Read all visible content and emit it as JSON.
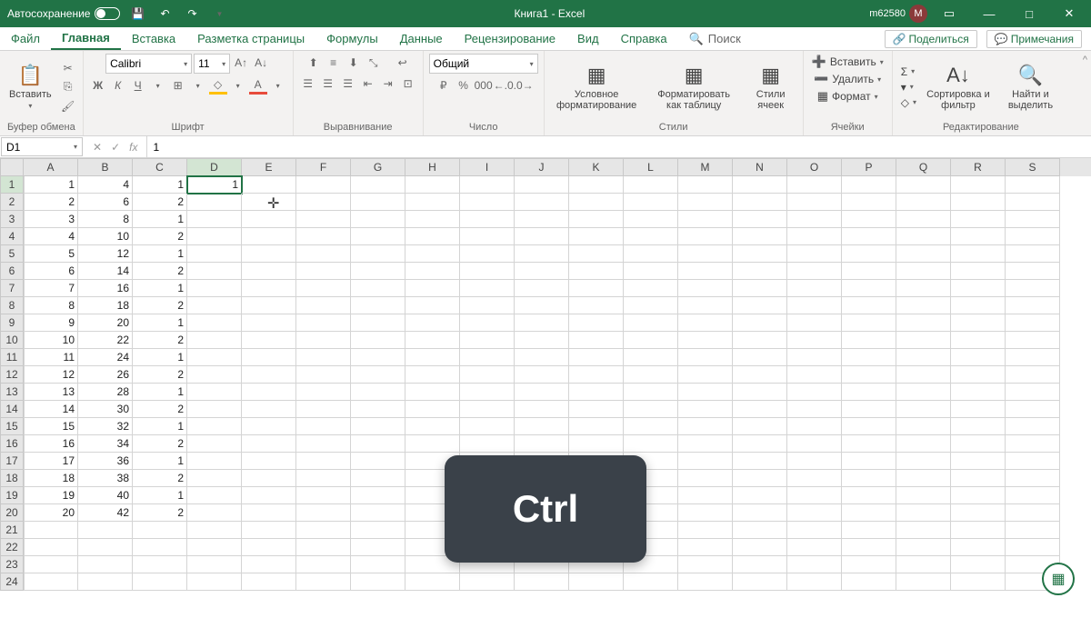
{
  "titlebar": {
    "autosave": "Автосохранение",
    "title": "Книга1 - Excel",
    "user_id": "m62580",
    "user_initial": "М"
  },
  "tabs": {
    "file": "Файл",
    "items": [
      "Главная",
      "Вставка",
      "Разметка страницы",
      "Формулы",
      "Данные",
      "Рецензирование",
      "Вид",
      "Справка"
    ],
    "search": "Поиск",
    "share": "Поделиться",
    "comments": "Примечания"
  },
  "ribbon": {
    "clipboard": {
      "paste": "Вставить",
      "label": "Буфер обмена"
    },
    "font": {
      "name": "Calibri",
      "size": "11",
      "label": "Шрифт"
    },
    "align": {
      "label": "Выравнивание"
    },
    "number": {
      "format": "Общий",
      "label": "Число"
    },
    "styles": {
      "cond": "Условное форматирование",
      "table": "Форматировать как таблицу",
      "cell": "Стили ячеек",
      "label": "Стили"
    },
    "cells": {
      "insert": "Вставить",
      "delete": "Удалить",
      "format": "Формат",
      "label": "Ячейки"
    },
    "editing": {
      "sort": "Сортировка и фильтр",
      "find": "Найти и выделить",
      "label": "Редактирование"
    }
  },
  "namebox": "D1",
  "formula": "1",
  "columns": [
    "A",
    "B",
    "C",
    "D",
    "E",
    "F",
    "G",
    "H",
    "I",
    "J",
    "K",
    "L",
    "M",
    "N",
    "O",
    "P",
    "Q",
    "R",
    "S"
  ],
  "active_col": "D",
  "active_row": 1,
  "rows_count": 24,
  "chart_data": {
    "type": "table",
    "columns": [
      "A",
      "B",
      "C",
      "D"
    ],
    "data": [
      [
        1,
        4,
        1,
        1
      ],
      [
        2,
        6,
        2,
        null
      ],
      [
        3,
        8,
        1,
        null
      ],
      [
        4,
        10,
        2,
        null
      ],
      [
        5,
        12,
        1,
        null
      ],
      [
        6,
        14,
        2,
        null
      ],
      [
        7,
        16,
        1,
        null
      ],
      [
        8,
        18,
        2,
        null
      ],
      [
        9,
        20,
        1,
        null
      ],
      [
        10,
        22,
        2,
        null
      ],
      [
        11,
        24,
        1,
        null
      ],
      [
        12,
        26,
        2,
        null
      ],
      [
        13,
        28,
        1,
        null
      ],
      [
        14,
        30,
        2,
        null
      ],
      [
        15,
        32,
        1,
        null
      ],
      [
        16,
        34,
        2,
        null
      ],
      [
        17,
        36,
        1,
        null
      ],
      [
        18,
        38,
        2,
        null
      ],
      [
        19,
        40,
        1,
        null
      ],
      [
        20,
        42,
        2,
        null
      ]
    ]
  },
  "overlay_key": "Ctrl"
}
